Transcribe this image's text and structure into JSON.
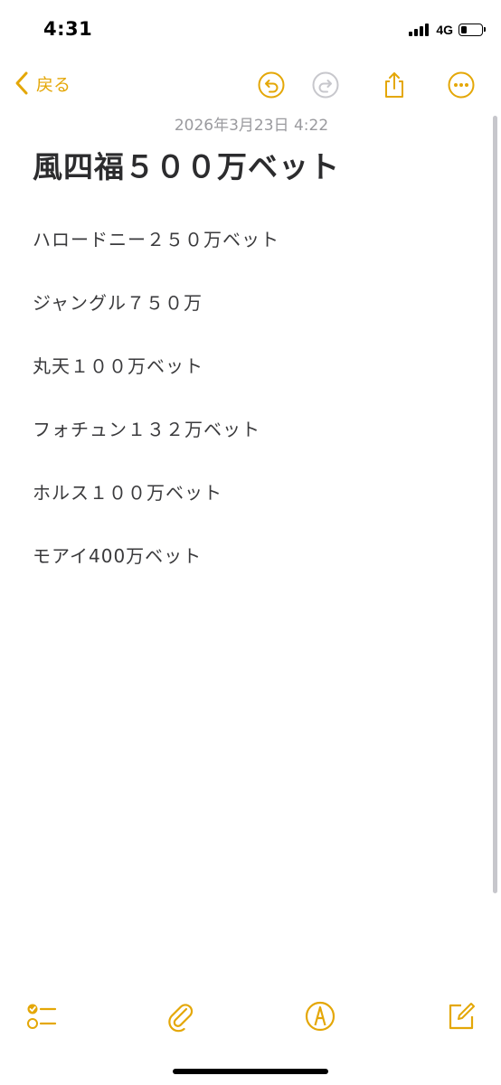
{
  "status_bar": {
    "time": "4:31",
    "network": "4G",
    "battery_level": 0.3
  },
  "nav": {
    "back_label": "戻る",
    "icons": [
      "undo-icon",
      "redo-icon",
      "share-icon",
      "more-icon"
    ],
    "redo_enabled": false
  },
  "note": {
    "date": "2026年3月23日 4:22",
    "title": "風四福５００万ベット",
    "lines": [
      "ハロードニー２５０万ベット",
      "ジャングル７５０万",
      "丸天１００万ベット",
      "フォチュン１３２万ベット",
      "ホルス１００万ベット",
      "モアイ400万ベット"
    ]
  },
  "toolbar": {
    "icons": [
      "checklist-icon",
      "attachment-icon",
      "markup-icon",
      "compose-icon"
    ]
  },
  "colors": {
    "accent": "#e4a707",
    "text": "#3a3a3c",
    "date": "#9a9a9e",
    "disabled": "#c7c7cc"
  }
}
